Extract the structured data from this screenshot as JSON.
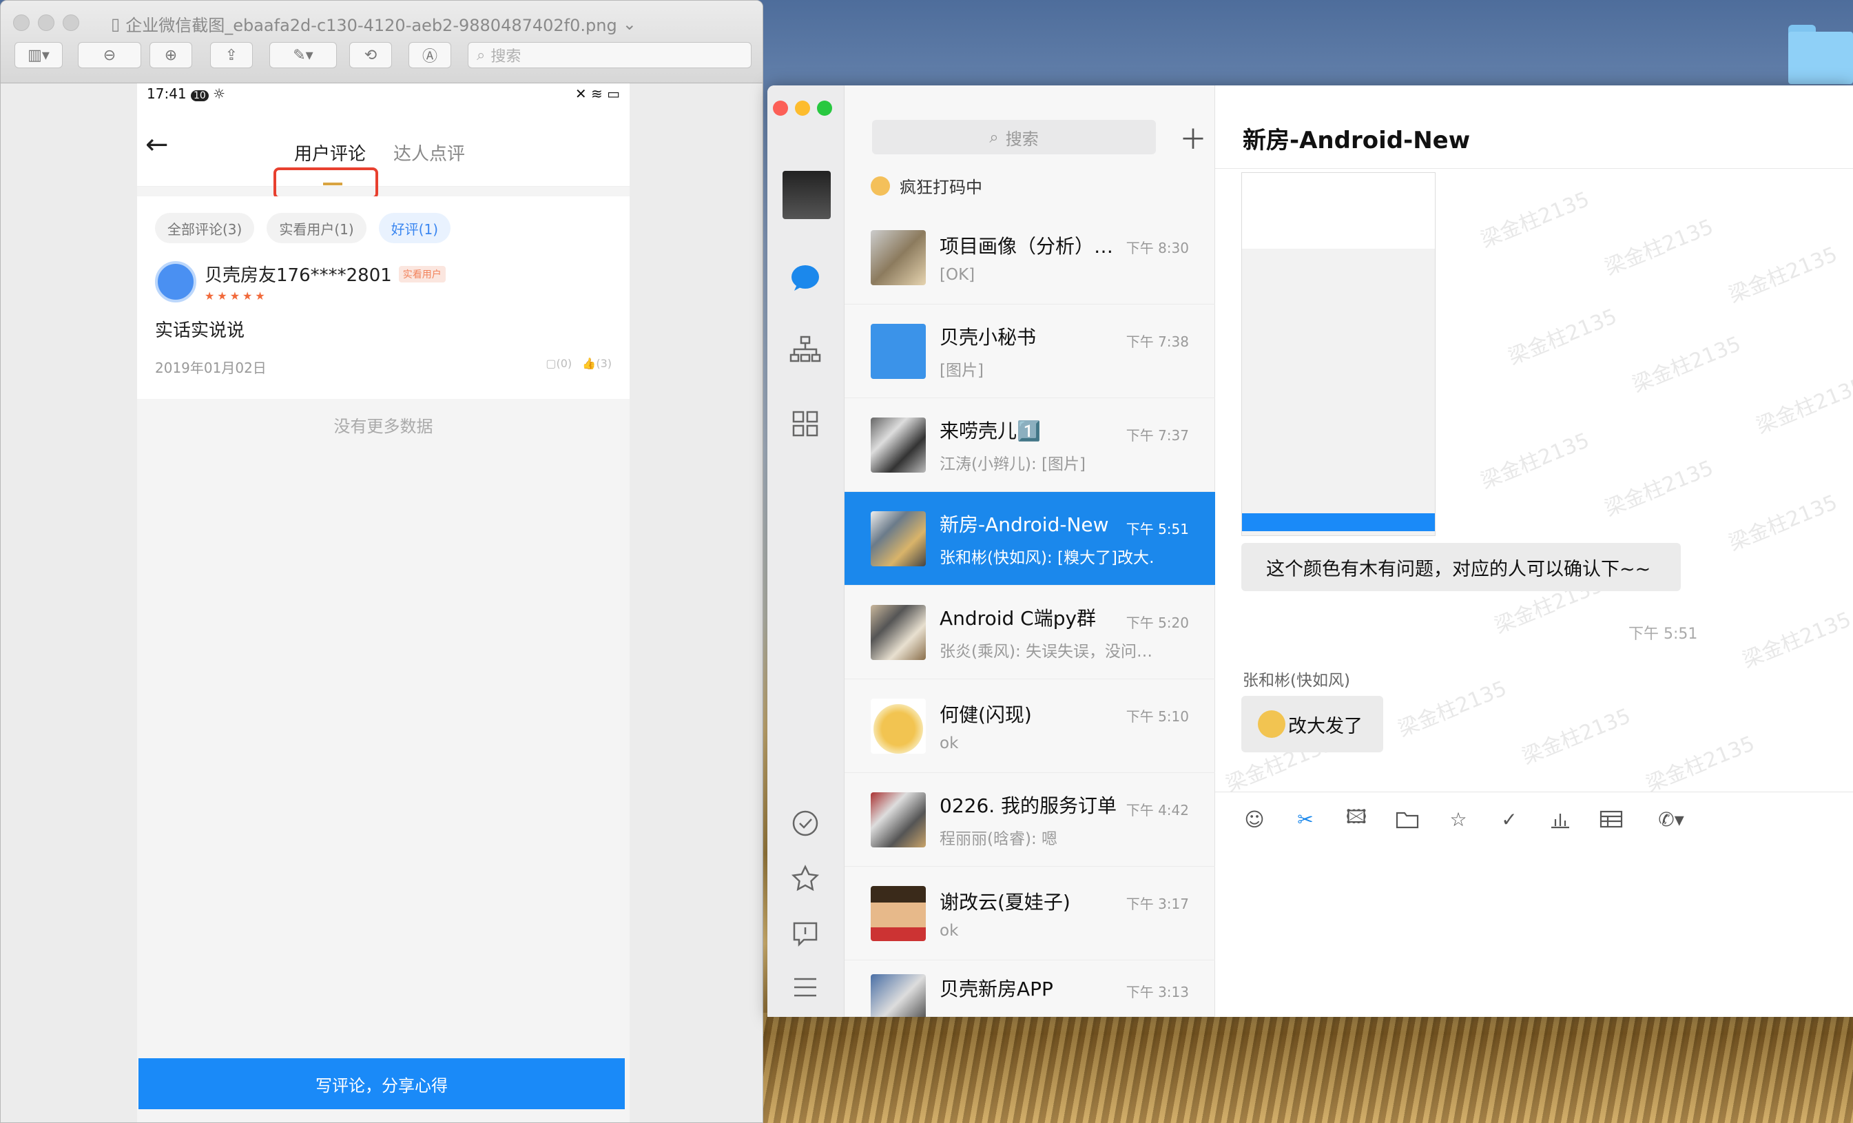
{
  "preview": {
    "title": "企业微信截图_ebaafa2d-c130-4120-aeb2-9880487402f0.png",
    "title_chevron": "⌄",
    "search_placeholder": "搜索"
  },
  "phone": {
    "time": "17:41",
    "notif_count": "10",
    "tabs": [
      "用户评论",
      "达人点评"
    ],
    "chips": [
      "全部评论(3)",
      "实看用户(1)",
      "好评(1)"
    ],
    "reviewer": "贝壳房友176****2801",
    "badge": "实看用户",
    "stars": "★★★★★",
    "review_text": "实话实说说",
    "date": "2019年01月02日",
    "comment_count": "(0)",
    "like_count": "(3)",
    "no_more": "没有更多数据",
    "write_btn": "写评论，分享心得"
  },
  "wechat": {
    "search_placeholder": "搜索",
    "status": "疯狂打码中",
    "conversations": [
      {
        "name": "项目画像（分析）…",
        "preview": "[OK]",
        "time": "下午 8:30"
      },
      {
        "name": "贝壳小秘书",
        "preview": "[图片]",
        "time": "下午 7:38"
      },
      {
        "name": "来唠壳儿1️⃣",
        "preview": "江涛(小辫儿): [图片]",
        "time": "下午 7:37"
      },
      {
        "name": "新房-Android-New",
        "preview": "张和彬(快如风): [糗大了]改大…",
        "time": "下午 5:51"
      },
      {
        "name": "Android C端py群",
        "preview": "张炎(乘风): 失误失误，没问…",
        "time": "下午 5:20"
      },
      {
        "name": "何健(闪现)",
        "preview": "ok",
        "time": "下午 5:10"
      },
      {
        "name": "0226. 我的服务订单",
        "preview": "程丽丽(晗睿): 嗯",
        "time": "下午 4:42"
      },
      {
        "name": "谢改云(夏娃子)",
        "preview": "ok",
        "time": "下午 3:17"
      },
      {
        "name": "贝壳新房APP",
        "preview": "",
        "time": "下午 3:13"
      }
    ],
    "chat_title": "新房-Android-New",
    "message1": "这个颜色有木有问题，对应的人可以确认下~~",
    "timestamp": "下午 5:51",
    "sender": "张和彬(快如风)",
    "message2": "改大发了",
    "watermark": "梁金柱2135"
  },
  "colors": {
    "accent": "#1b88ec",
    "red_box": "#e8402f"
  }
}
